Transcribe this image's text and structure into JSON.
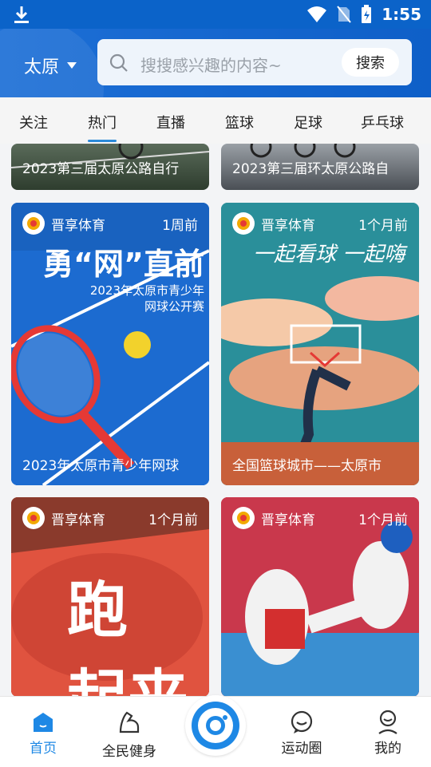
{
  "status": {
    "time": "1:55"
  },
  "header": {
    "city": "太原",
    "search_placeholder": "搜搜感兴趣的内容~",
    "search_button": "搜索"
  },
  "tabs": [
    "关注",
    "热门",
    "直播",
    "篮球",
    "足球",
    "乒乓球"
  ],
  "active_tab": "热门",
  "top_partial_cards": [
    {
      "caption": "2023第三届太原公路自行"
    },
    {
      "caption": "2023第三届环太原公路自"
    }
  ],
  "cards": [
    {
      "source": "晋享体育",
      "time": "1周前",
      "caption": "2023年太原市青少年网球",
      "poster_title": "勇“网”直前",
      "poster_sub1": "2023年太原市青少年",
      "poster_sub2": "网球公开赛"
    },
    {
      "source": "晋享体育",
      "time": "1个月前",
      "caption": "全国篮球城市——太原市",
      "poster_title": "一起看球 一起嗨"
    },
    {
      "source": "晋享体育",
      "time": "1个月前",
      "caption": "",
      "poster_title": "跑 起来"
    },
    {
      "source": "晋享体育",
      "time": "1个月前",
      "caption": ""
    }
  ],
  "bottom_nav": [
    "首页",
    "全民健身",
    "运动圈",
    "我的"
  ],
  "colors": {
    "primary": "#0e5fc8",
    "accent": "#1e88e5"
  }
}
